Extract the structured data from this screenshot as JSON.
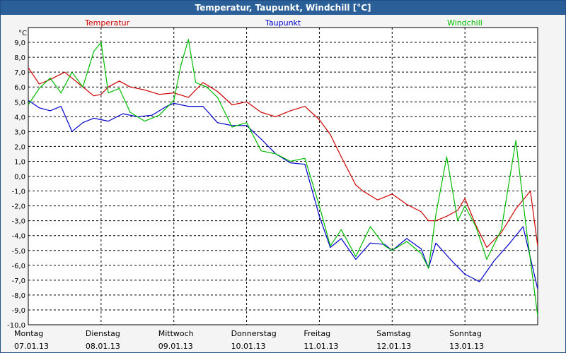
{
  "window": {
    "title": "Temperatur, Taupunkt, Windchill [°C]"
  },
  "chart_data": {
    "type": "line",
    "title": "Temperatur, Taupunkt, Windchill [°C]",
    "ylabel": "°C",
    "ylim": [
      -10,
      10
    ],
    "yticks": [
      "9,0",
      "8,0",
      "7,0",
      "6,0",
      "5,0",
      "4,0",
      "3,0",
      "2,0",
      "1,0",
      "0,0",
      "-1,0",
      "-2,0",
      "-3,0",
      "-4,0",
      "-5,0",
      "-6,0",
      "-7,0",
      "-8,0",
      "-9,0",
      "-10,0"
    ],
    "xlim": [
      0,
      7
    ],
    "days": [
      {
        "weekday": "Montag",
        "date": "07.01.13"
      },
      {
        "weekday": "Dienstag",
        "date": "08.01.13"
      },
      {
        "weekday": "Mittwoch",
        "date": "09.01.13"
      },
      {
        "weekday": "Donnerstag",
        "date": "10.01.13"
      },
      {
        "weekday": "Freitag",
        "date": "11.01.13"
      },
      {
        "weekday": "Samstag",
        "date": "12.01.13"
      },
      {
        "weekday": "Sonntag",
        "date": "13.01.13"
      }
    ],
    "grid": true,
    "legend_position": "top",
    "series": [
      {
        "name": "Temperatur",
        "color": "#cc0000",
        "x": [
          0,
          0.15,
          0.3,
          0.5,
          0.7,
          0.9,
          1.0,
          1.1,
          1.25,
          1.4,
          1.6,
          1.8,
          2.0,
          2.2,
          2.4,
          2.6,
          2.8,
          3.0,
          3.2,
          3.4,
          3.6,
          3.8,
          4.0,
          4.15,
          4.3,
          4.5,
          4.6,
          4.8,
          5.0,
          5.2,
          5.4,
          5.5,
          5.6,
          5.75,
          5.9,
          6.0,
          6.15,
          6.3,
          6.5,
          6.7,
          6.9,
          7.0
        ],
        "y": [
          7.3,
          6.2,
          6.5,
          7.0,
          6.2,
          5.4,
          5.5,
          6.0,
          6.4,
          6.0,
          5.8,
          5.5,
          5.6,
          5.3,
          6.3,
          5.7,
          4.8,
          5.0,
          4.3,
          4.0,
          4.4,
          4.7,
          3.8,
          2.8,
          1.3,
          -0.6,
          -1.0,
          -1.6,
          -1.2,
          -1.9,
          -2.4,
          -3.0,
          -3.0,
          -2.7,
          -2.3,
          -1.5,
          -3.3,
          -4.8,
          -3.8,
          -2.2,
          -1.0,
          -4.7
        ]
      },
      {
        "name": "Taupunkt",
        "color": "#0000cc",
        "x": [
          0,
          0.15,
          0.3,
          0.45,
          0.6,
          0.75,
          0.9,
          1.1,
          1.3,
          1.5,
          1.7,
          1.9,
          2.0,
          2.2,
          2.4,
          2.6,
          2.8,
          3.0,
          3.2,
          3.4,
          3.6,
          3.8,
          4.0,
          4.15,
          4.3,
          4.5,
          4.7,
          4.9,
          5.0,
          5.2,
          5.4,
          5.5,
          5.6,
          5.8,
          6.0,
          6.2,
          6.4,
          6.6,
          6.8,
          7.0
        ],
        "y": [
          5.1,
          4.6,
          4.4,
          4.7,
          3.0,
          3.6,
          3.9,
          3.7,
          4.2,
          4.0,
          4.1,
          4.7,
          4.9,
          4.7,
          4.7,
          3.6,
          3.4,
          3.4,
          2.5,
          1.5,
          0.9,
          0.8,
          -2.7,
          -4.8,
          -4.2,
          -5.6,
          -4.5,
          -4.6,
          -5.0,
          -4.2,
          -4.9,
          -6.2,
          -4.5,
          -5.6,
          -6.6,
          -7.1,
          -5.7,
          -4.6,
          -3.4,
          -7.6
        ]
      },
      {
        "name": "Windchill",
        "color": "#00bb00",
        "x": [
          0,
          0.15,
          0.3,
          0.45,
          0.6,
          0.75,
          0.9,
          1.0,
          1.1,
          1.25,
          1.4,
          1.6,
          1.8,
          2.0,
          2.1,
          2.2,
          2.3,
          2.45,
          2.6,
          2.8,
          3.0,
          3.2,
          3.4,
          3.6,
          3.8,
          4.0,
          4.15,
          4.3,
          4.5,
          4.7,
          4.9,
          5.0,
          5.2,
          5.4,
          5.5,
          5.6,
          5.75,
          5.9,
          6.0,
          6.15,
          6.3,
          6.5,
          6.7,
          6.85,
          7.0
        ],
        "y": [
          4.8,
          5.9,
          6.6,
          5.6,
          7.0,
          6.0,
          8.4,
          9.0,
          5.6,
          5.9,
          4.3,
          3.7,
          4.1,
          5.1,
          7.5,
          9.2,
          6.3,
          6.0,
          5.3,
          3.3,
          3.6,
          1.7,
          1.5,
          1.0,
          1.2,
          -2.0,
          -4.7,
          -3.6,
          -5.4,
          -3.4,
          -4.7,
          -5.0,
          -4.4,
          -5.2,
          -6.2,
          -2.6,
          1.3,
          -3.0,
          -2.0,
          -3.4,
          -5.6,
          -3.6,
          2.4,
          -3.8,
          -9.4
        ]
      }
    ]
  }
}
